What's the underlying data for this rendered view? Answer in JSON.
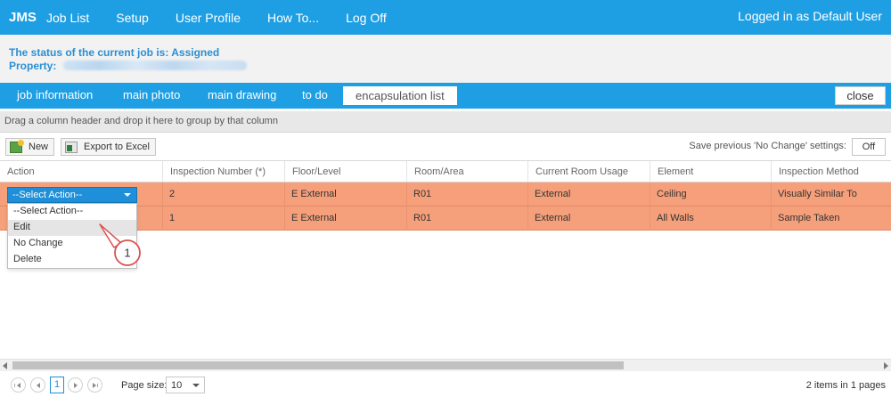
{
  "nav": {
    "brand": "JMS",
    "links": [
      "Job List",
      "Setup",
      "User Profile",
      "How To...",
      "Log Off"
    ],
    "logged_in": "Logged in as Default User"
  },
  "job": {
    "status_line": "The status of the current job is: Assigned",
    "property_label": "Property:"
  },
  "tabs": {
    "items": [
      "job information",
      "main photo",
      "main drawing",
      "to do",
      "encapsulation list"
    ],
    "active": "encapsulation list",
    "close_label": "close"
  },
  "grid": {
    "group_hint": "Drag a column header and drop it here to group by that column",
    "toolbar": {
      "new_label": "New",
      "export_label": "Export to Excel",
      "save_setting_label": "Save previous 'No Change' settings:",
      "save_setting_value": "Off"
    },
    "columns": [
      "Action",
      "Inspection Number (*)",
      "Floor/Level",
      "Room/Area",
      "Current Room Usage",
      "Element",
      "Inspection Method"
    ],
    "rows": [
      {
        "inspection_number": "2",
        "floor": "E External",
        "room": "R01",
        "usage": "External",
        "element": "Ceiling",
        "method": "Visually Similar To"
      },
      {
        "inspection_number": "1",
        "floor": "E External",
        "room": "R01",
        "usage": "External",
        "element": "All Walls",
        "method": "Sample Taken"
      }
    ],
    "row_color": "#f6a07b",
    "action_select": {
      "value": "--Select Action--",
      "options": [
        "--Select Action--",
        "Edit",
        "No Change",
        "Delete"
      ],
      "highlighted": "Edit"
    },
    "callout_number": "1"
  },
  "pager": {
    "current_page": "1",
    "page_size_label": "Page size:",
    "page_size": "10",
    "info": "2 items in 1 pages"
  },
  "colors": {
    "accent": "#1e9fe3",
    "row_highlight": "#f6a07b",
    "callout": "#d9534f"
  }
}
